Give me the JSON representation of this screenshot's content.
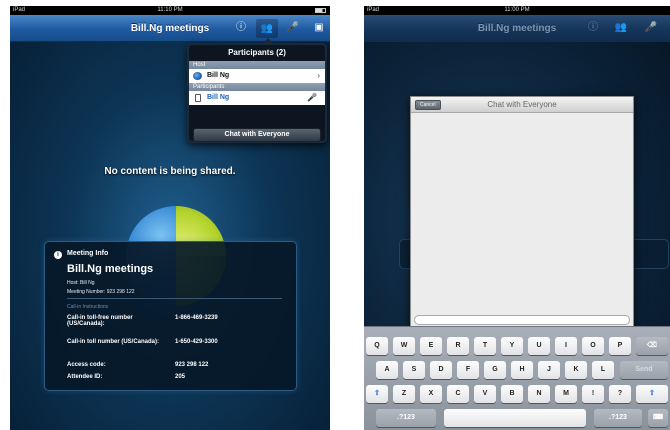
{
  "left": {
    "status": {
      "device": "iPad",
      "time": "11:10 PM"
    },
    "navbar": {
      "title": "Bill.Ng meetings",
      "icons": [
        "info-icon",
        "participants-icon",
        "microphone-icon",
        "panel-icon"
      ]
    },
    "popover": {
      "title": "Participants (2)",
      "host_header": "Host",
      "host_name": "Bill Ng",
      "participants_header": "Participants",
      "participant_name": "Bill Ng",
      "chat_button": "Chat with Everyone"
    },
    "no_content": "No content is being shared.",
    "meeting_info": {
      "header": "Meeting Info",
      "title": "Bill.Ng meetings",
      "host": "Host: Bill Ng",
      "number": "Meeting Number: 923 298 122",
      "callin_header": "Call-in Instructions",
      "rows": [
        {
          "label": "Call-in toll-free number (US/Canada):",
          "value": "1-866-469-3239"
        },
        {
          "label": "Call-in toll number (US/Canada):",
          "value": "1-650-429-3300"
        },
        {
          "label": "Access code:",
          "value": "923 298 122"
        },
        {
          "label": "Attendee ID:",
          "value": "205"
        }
      ]
    }
  },
  "right": {
    "status": {
      "device": "iPad",
      "time": "11:00 PM"
    },
    "navbar": {
      "title": "Bill.Ng meetings"
    },
    "chat": {
      "cancel": "Cancel",
      "title": "Chat with Everyone"
    },
    "keyboard": {
      "row1": [
        "Q",
        "W",
        "E",
        "R",
        "T",
        "Y",
        "U",
        "I",
        "O",
        "P"
      ],
      "row2": [
        "A",
        "S",
        "D",
        "F",
        "G",
        "H",
        "J",
        "K",
        "L"
      ],
      "send": "Send",
      "row3": [
        "Z",
        "X",
        "C",
        "V",
        "B",
        "N",
        "M",
        "!",
        "?"
      ],
      "numbers_left": ".?123",
      "numbers_right": ".?123"
    }
  }
}
